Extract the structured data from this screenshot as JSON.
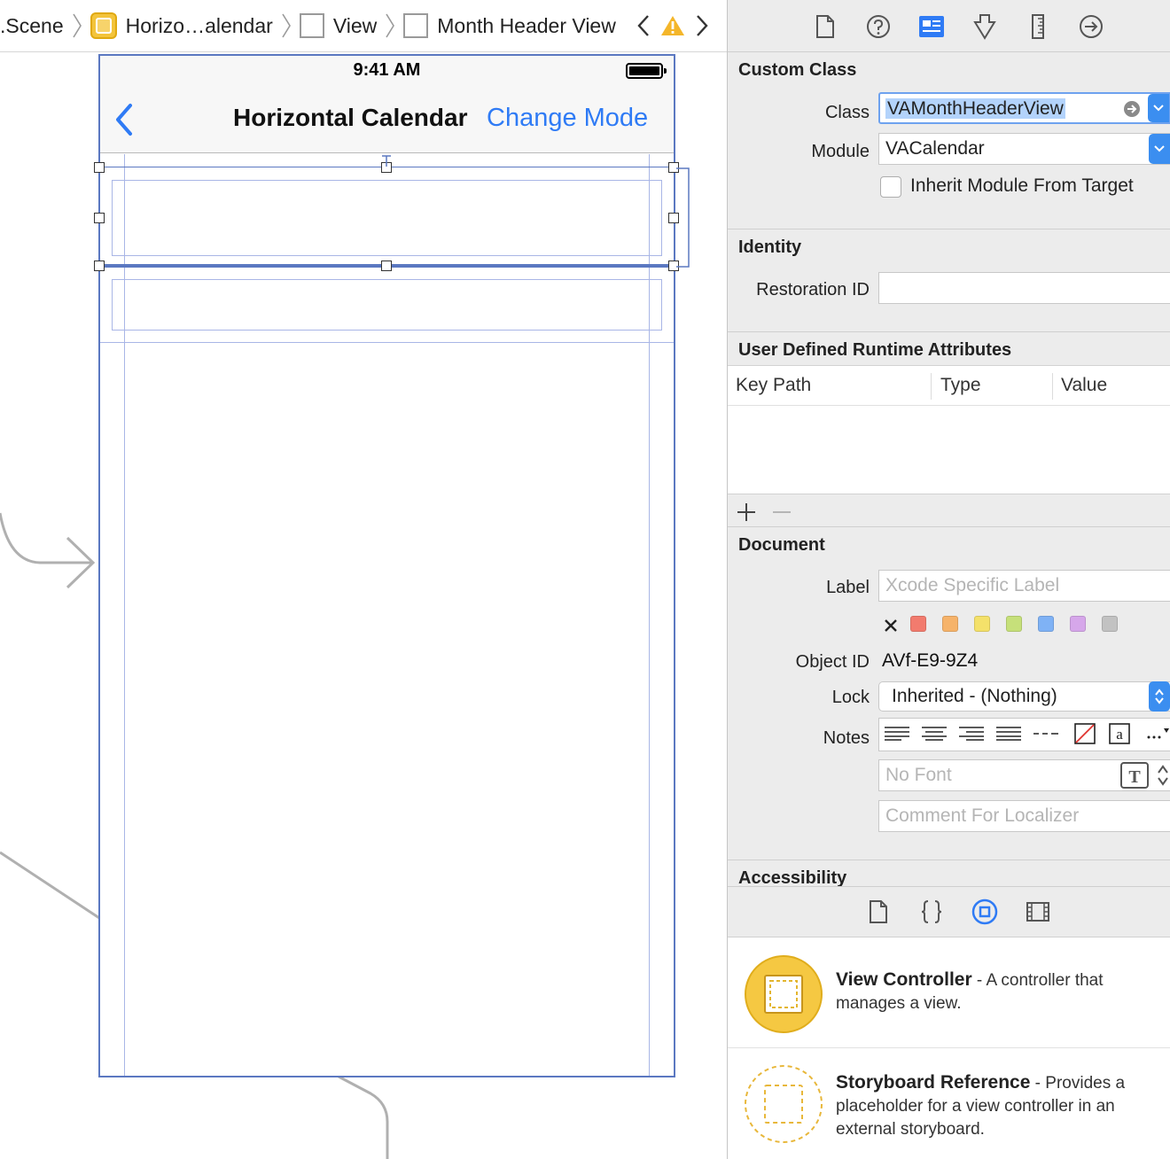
{
  "breadcrumb": {
    "items": [
      {
        "label": ".Scene"
      },
      {
        "label": "Horizo…alendar"
      },
      {
        "label": "View"
      },
      {
        "label": "Month Header View"
      }
    ]
  },
  "device": {
    "status_time": "9:41 AM",
    "nav_title": "Horizontal Calendar",
    "nav_action": "Change Mode"
  },
  "inspector": {
    "custom_class": {
      "title": "Custom Class",
      "class_label": "Class",
      "class_value": "VAMonthHeaderView",
      "module_label": "Module",
      "module_value": "VACalendar",
      "inherit_label": "Inherit Module From Target"
    },
    "identity": {
      "title": "Identity",
      "restoration_label": "Restoration ID",
      "restoration_value": ""
    },
    "runtime_attrs": {
      "title": "User Defined Runtime Attributes",
      "columns": [
        "Key Path",
        "Type",
        "Value"
      ]
    },
    "document": {
      "title": "Document",
      "label_label": "Label",
      "label_placeholder": "Xcode Specific Label",
      "object_id_label": "Object ID",
      "object_id_value": "AVf-E9-9Z4",
      "lock_label": "Lock",
      "lock_value": "Inherited - (Nothing)",
      "notes_label": "Notes",
      "font_placeholder": "No Font",
      "comment_placeholder": "Comment For Localizer",
      "label_colors": [
        "#f27b6e",
        "#f6b36a",
        "#f4e16a",
        "#c6e07a",
        "#7fb2f5",
        "#d6a7ea",
        "#c2c2c2"
      ]
    },
    "accessibility_title": "Accessibility"
  },
  "library": {
    "items": [
      {
        "name": "View Controller",
        "desc": " - A controller that manages a view."
      },
      {
        "name": "Storyboard Reference",
        "desc": " - Provides a placeholder for a view controller in an external storyboard."
      }
    ]
  },
  "colors": {
    "accent": "#2f7bf5",
    "selection": "#5b78c1",
    "vc_yellow": "#f3c43b"
  }
}
